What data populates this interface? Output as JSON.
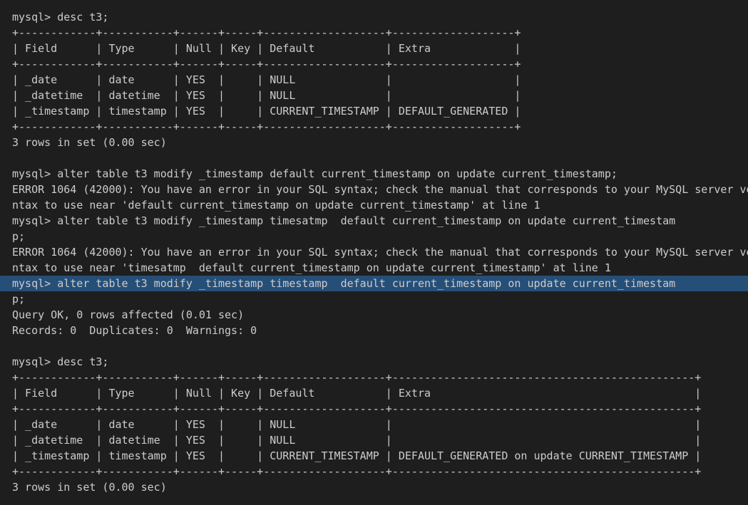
{
  "terminal": {
    "background": "#1e1e1e",
    "foreground": "#cccccc",
    "selection_color": "#264f78",
    "lines": [
      {
        "text": "mysql> desc t3;",
        "highlight": false
      },
      {
        "text": "+------------+-----------+------+-----+-------------------+-------------------+",
        "highlight": false
      },
      {
        "text": "| Field      | Type      | Null | Key | Default           | Extra             |",
        "highlight": false
      },
      {
        "text": "+------------+-----------+------+-----+-------------------+-------------------+",
        "highlight": false
      },
      {
        "text": "| _date      | date      | YES  |     | NULL              |                   |",
        "highlight": false
      },
      {
        "text": "| _datetime  | datetime  | YES  |     | NULL              |                   |",
        "highlight": false
      },
      {
        "text": "| _timestamp | timestamp | YES  |     | CURRENT_TIMESTAMP | DEFAULT_GENERATED |",
        "highlight": false
      },
      {
        "text": "+------------+-----------+------+-----+-------------------+-------------------+",
        "highlight": false
      },
      {
        "text": "3 rows in set (0.00 sec)",
        "highlight": false
      },
      {
        "text": "",
        "highlight": false
      },
      {
        "text": "mysql> alter table t3 modify _timestamp default current_timestamp on update current_timestamp;",
        "highlight": false
      },
      {
        "text": "ERROR 1064 (42000): You have an error in your SQL syntax; check the manual that corresponds to your MySQL server ve",
        "highlight": false
      },
      {
        "text": "ntax to use near 'default current_timestamp on update current_timestamp' at line 1",
        "highlight": false
      },
      {
        "text": "mysql> alter table t3 modify _timestamp timesatmp  default current_timestamp on update current_timestam",
        "highlight": false
      },
      {
        "text": "p;",
        "highlight": false
      },
      {
        "text": "ERROR 1064 (42000): You have an error in your SQL syntax; check the manual that corresponds to your MySQL server ve",
        "highlight": false
      },
      {
        "text": "ntax to use near 'timesatmp  default current_timestamp on update current_timestamp' at line 1",
        "highlight": false
      },
      {
        "text": "mysql> alter table t3 modify _timestamp timestamp  default current_timestamp on update current_timestam",
        "highlight": true
      },
      {
        "text": "p;",
        "highlight": false
      },
      {
        "text": "Query OK, 0 rows affected (0.01 sec)",
        "highlight": false
      },
      {
        "text": "Records: 0  Duplicates: 0  Warnings: 0",
        "highlight": false
      },
      {
        "text": "",
        "highlight": false
      },
      {
        "text": "mysql> desc t3;",
        "highlight": false
      },
      {
        "text": "+------------+-----------+------+-----+-------------------+-----------------------------------------------+",
        "highlight": false
      },
      {
        "text": "| Field      | Type      | Null | Key | Default           | Extra                                         |",
        "highlight": false
      },
      {
        "text": "+------------+-----------+------+-----+-------------------+-----------------------------------------------+",
        "highlight": false
      },
      {
        "text": "| _date      | date      | YES  |     | NULL              |                                               |",
        "highlight": false
      },
      {
        "text": "| _datetime  | datetime  | YES  |     | NULL              |                                               |",
        "highlight": false
      },
      {
        "text": "| _timestamp | timestamp | YES  |     | CURRENT_TIMESTAMP | DEFAULT_GENERATED on update CURRENT_TIMESTAMP |",
        "highlight": false
      },
      {
        "text": "+------------+-----------+------+-----+-------------------+-----------------------------------------------+",
        "highlight": false
      },
      {
        "text": "3 rows in set (0.00 sec)",
        "highlight": false
      }
    ]
  }
}
